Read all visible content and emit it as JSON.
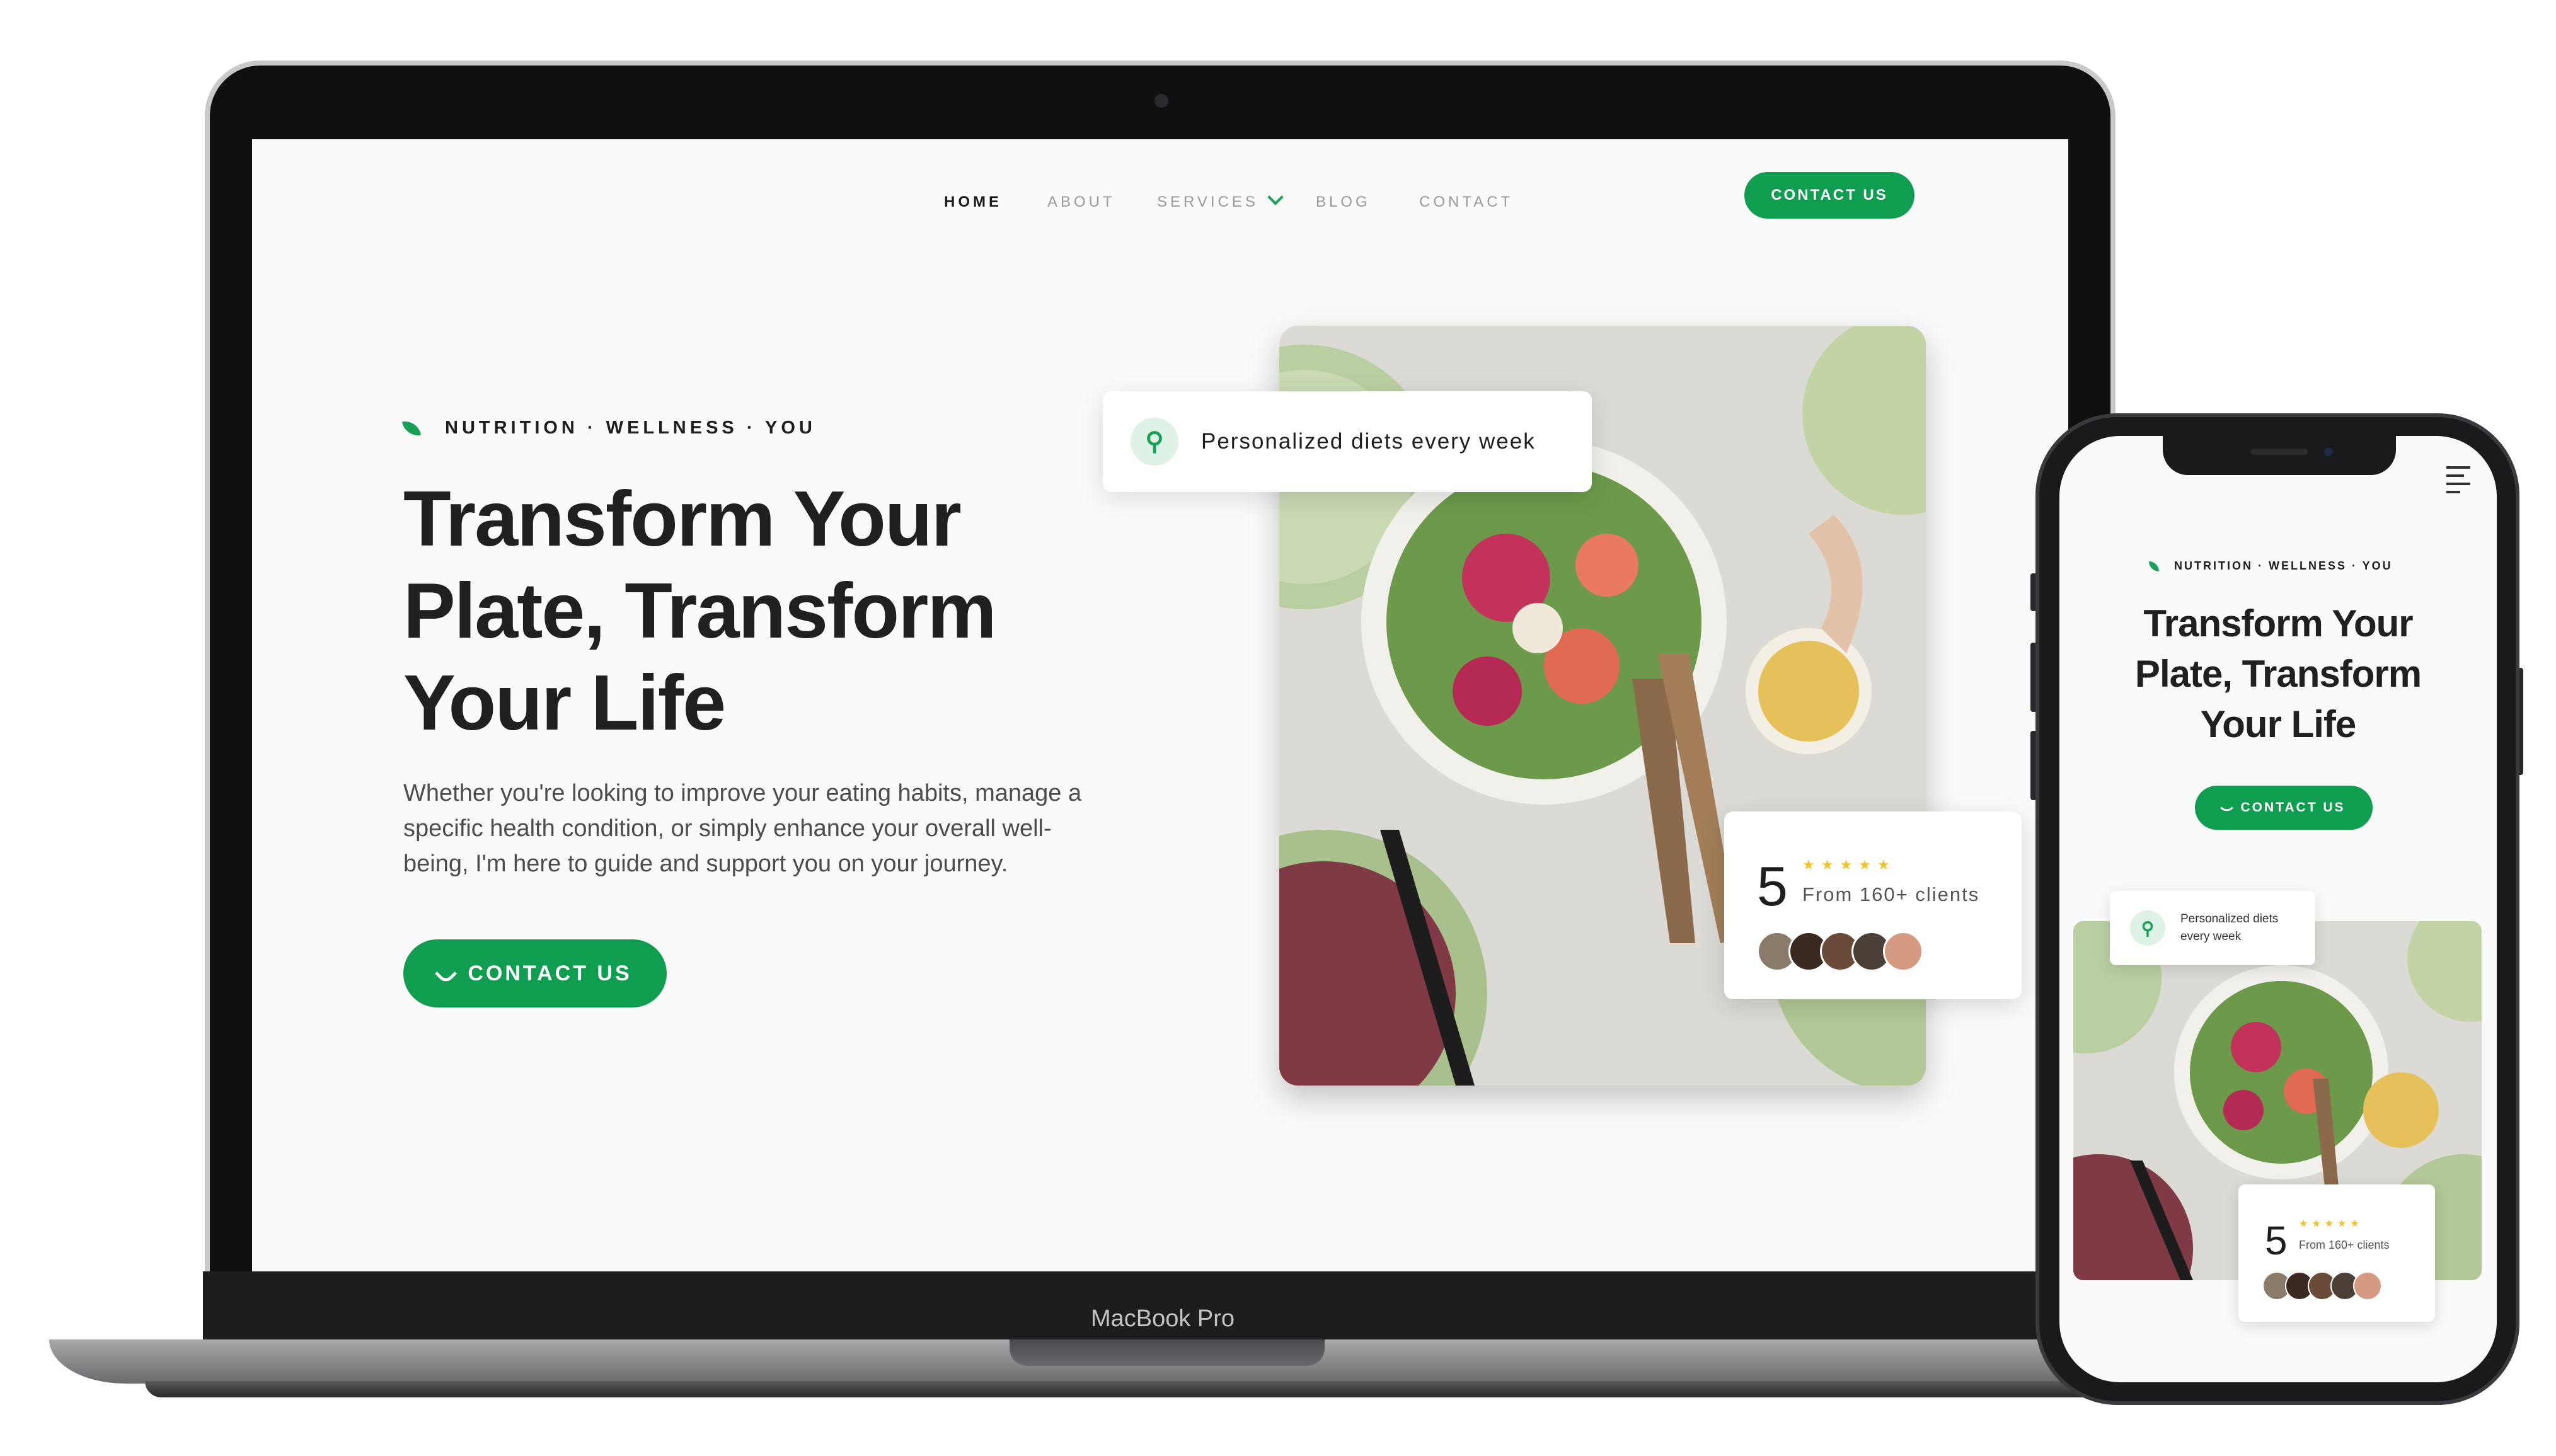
{
  "laptop": {
    "brand": "MacBook Pro",
    "nav": {
      "items": [
        "HOME",
        "ABOUT",
        "SERVICES",
        "BLOG",
        "CONTACT"
      ],
      "active": "HOME",
      "cta": "CONTACT US"
    },
    "hero": {
      "eyebrow": "NUTRITION · WELLNESS · YOU",
      "title_lines": [
        "Transform Your",
        "Plate, Transform",
        "Your Life"
      ],
      "description": "Whether you're looking to improve your eating habits, manage a specific health condition, or simply enhance your overall well-being, I'm here to guide and support you on your journey.",
      "cta": "CONTACT US"
    },
    "badge_diets": {
      "icon": "fork-knife-icon",
      "text": "Personalized diets every week"
    },
    "badge_rating": {
      "number": "5",
      "stars": "★★★★★",
      "text": "From 160+ clients",
      "avatars": 5
    }
  },
  "phone": {
    "eyebrow": "NUTRITION · WELLNESS · YOU",
    "title_lines": [
      "Transform Your",
      "Plate, Transform",
      "Your Life"
    ],
    "cta": "CONTACT US",
    "badge_diets": {
      "icon": "fork-knife-icon",
      "text": "Personalized diets every week"
    },
    "badge_rating": {
      "number": "5",
      "stars": "★★★★★",
      "text": "From 160+ clients",
      "avatars": 5
    }
  },
  "colors": {
    "accent": "#0f9d4f",
    "star": "#f2c12e",
    "text": "#202020"
  }
}
